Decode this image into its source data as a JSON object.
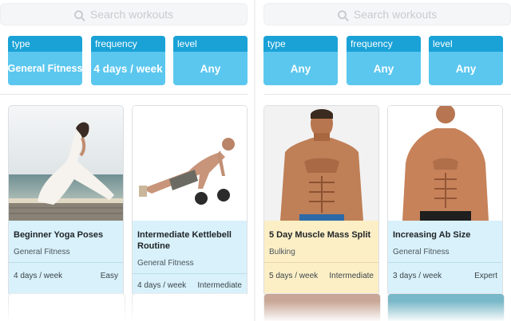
{
  "left": {
    "search": {
      "placeholder": "Search workouts"
    },
    "filters": [
      {
        "label": "type",
        "value": "General Fitness"
      },
      {
        "label": "frequency",
        "value": "4 days / week"
      },
      {
        "label": "level",
        "value": "Any"
      }
    ],
    "cards": [
      {
        "title": "Beginner Yoga Poses",
        "category": "General Fitness",
        "frequency": "4 days / week",
        "level": "Easy",
        "image": "yoga-pose-photo"
      },
      {
        "title": "Intermediate Kettlebell Routine",
        "category": "General Fitness",
        "frequency": "4 days / week",
        "level": "Intermediate",
        "image": "kettlebell-pushup-photo"
      }
    ]
  },
  "right": {
    "search": {
      "placeholder": "Search workouts"
    },
    "filters": [
      {
        "label": "type",
        "value": "Any"
      },
      {
        "label": "frequency",
        "value": "Any"
      },
      {
        "label": "level",
        "value": "Any"
      }
    ],
    "cards": [
      {
        "title": "5 Day Muscle Mass Split",
        "category": "Bulking",
        "frequency": "5 days / week",
        "level": "Intermediate",
        "image": "muscular-man-photo"
      },
      {
        "title": "Increasing Ab Size",
        "category": "General Fitness",
        "frequency": "3 days / week",
        "level": "Expert",
        "image": "abs-man-photo"
      }
    ]
  },
  "colors": {
    "filter_header": "#1aa2d7",
    "filter_body": "#5bc7ef",
    "card_blue": "#d9f1fb",
    "card_yellow": "#fcefc6"
  }
}
